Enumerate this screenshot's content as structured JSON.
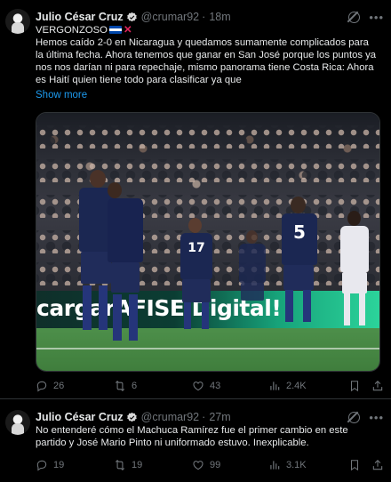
{
  "tweets": [
    {
      "author_name": "Julio César Cruz",
      "handle": "@crumar92",
      "separator": "·",
      "time": "18m",
      "lines": [
        "VERGONZOSO",
        "Hemos caído 2-0 en Nicaragua y quedamos sumamente complicados para",
        "la última fecha. Ahora tenemos que ganar en San José porque los puntos ya",
        "nos nos darían ni para repechaje, mismo panorama tiene Costa Rica: Ahora",
        "es Haití quien tiene todo para clasificar ya que"
      ],
      "show_more": "Show more",
      "photo": {
        "banner_prefix": "cargar",
        "banner_text": "AFISE Digital!",
        "jersey_numbers": [
          "17",
          "5"
        ]
      },
      "stats": {
        "replies": "26",
        "retweets": "6",
        "likes": "43",
        "views": "2.4K"
      }
    },
    {
      "author_name": "Julio César Cruz",
      "handle": "@crumar92",
      "separator": "·",
      "time": "27m",
      "lines": [
        "No entenderé cómo el Machuca Ramírez fue el primer cambio en este",
        "partido y José Mario Pinto ni uniformado estuvo. Inexplicable."
      ],
      "stats": {
        "replies": "19",
        "retweets": "19",
        "likes": "99",
        "views": "3.1K"
      }
    }
  ],
  "colors": {
    "background": "#000000",
    "text": "#e7e9ea",
    "muted": "#71767b",
    "link": "#1d9bf0",
    "verified_badge": "#d9d9d9",
    "x_mark": "#e0245e"
  },
  "icons": [
    "verified-icon",
    "grok-icon",
    "more-icon",
    "reply-icon",
    "retweet-icon",
    "like-icon",
    "views-icon",
    "bookmark-icon",
    "share-icon",
    "flag-icon",
    "cross-mark-icon"
  ]
}
